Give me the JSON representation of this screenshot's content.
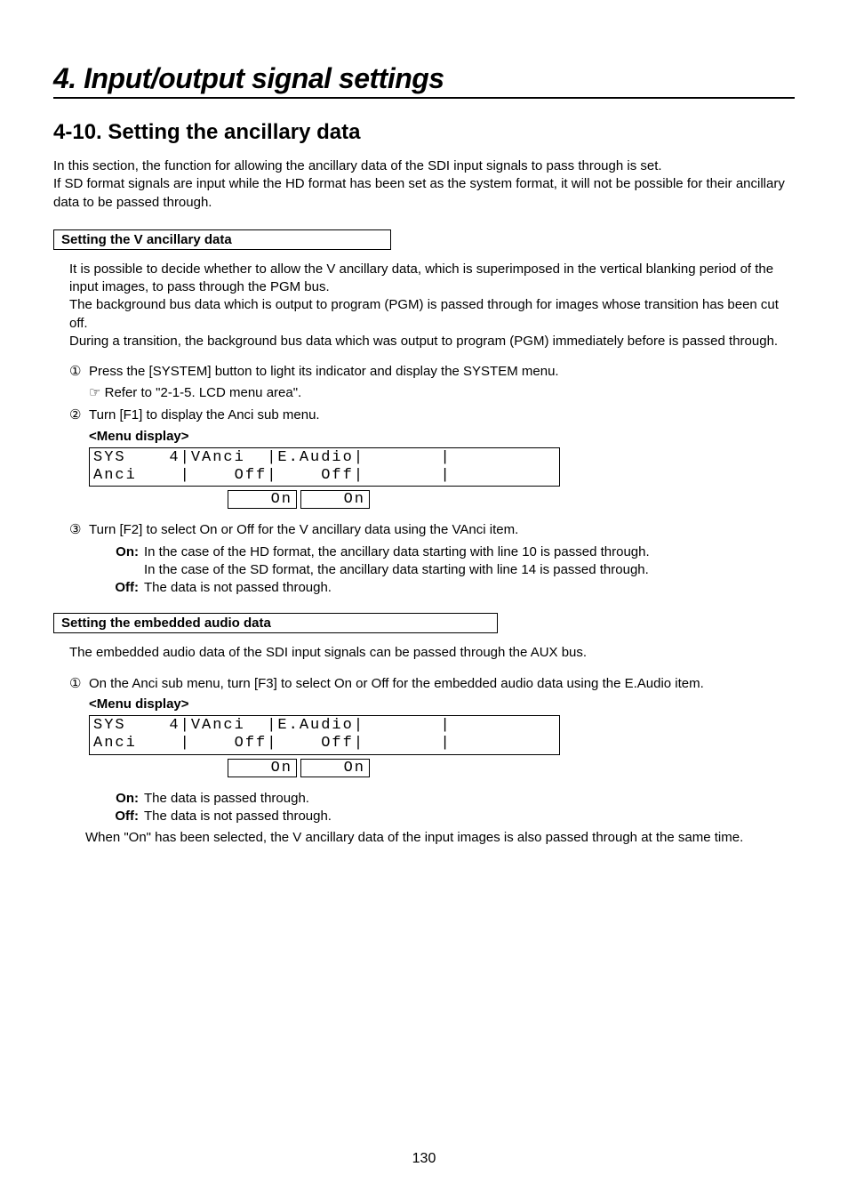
{
  "chapter": "4. Input/output signal settings",
  "section": "4-10. Setting the ancillary data",
  "intro": "In this section, the function for allowing the ancillary data of the SDI input signals to pass through is set.\nIf SD format signals are input while the HD format has been set as the system format, it will not be possible for their ancillary data to be passed through.",
  "sub1": {
    "heading": "Setting the V ancillary data",
    "body": "It is possible to decide whether to allow the V ancillary data, which is superimposed in the vertical blanking period of the input images, to pass through the PGM bus.\nThe background bus data which is output to program (PGM) is passed through for images whose transition has been cut off.\nDuring a transition, the background bus data which was output to program (PGM) immediately before is passed through.",
    "step1_num": "①",
    "step1": "Press the [SYSTEM] button to light its indicator and display the SYSTEM menu.",
    "ref_symbol": "☞",
    "ref": "Refer to \"2-1-5. LCD menu area\".",
    "step2_num": "②",
    "step2": "Turn [F1] to display the Anci sub menu.",
    "menu_label": "<Menu display>",
    "lcd_line1": "SYS    4|VAnci  |E.Audio|       |",
    "lcd_line2": "Anci    |    Off|    Off|       |",
    "opt1": "On",
    "opt2": "On",
    "step3_num": "③",
    "step3": "Turn [F2] to select On or Off for the V ancillary data using the VAnci item.",
    "on_label": "On:",
    "on_def": "In the case of the HD format, the ancillary data starting with line 10 is passed through.\nIn the case of the SD format, the ancillary data starting with line 14 is passed through.",
    "off_label": "Off:",
    "off_def": "The data is not passed through."
  },
  "sub2": {
    "heading": "Setting the embedded audio data",
    "body": "The embedded audio data of the SDI input signals can be passed through the AUX bus.",
    "step1_num": "①",
    "step1": "On the Anci sub menu, turn [F3] to select On or Off for the embedded audio data using the E.Audio item.",
    "menu_label": "<Menu display>",
    "lcd_line1": "SYS    4|VAnci  |E.Audio|       |",
    "lcd_line2": "Anci    |    Off|    Off|       |",
    "opt1": "On",
    "opt2": "On",
    "on_label": "On:",
    "on_def": "The data is passed through.",
    "off_label": "Off:",
    "off_def": "The data is not passed through.",
    "note": "When \"On\" has been selected, the V ancillary data of the input images is also passed through at the same time."
  },
  "page_number": "130"
}
